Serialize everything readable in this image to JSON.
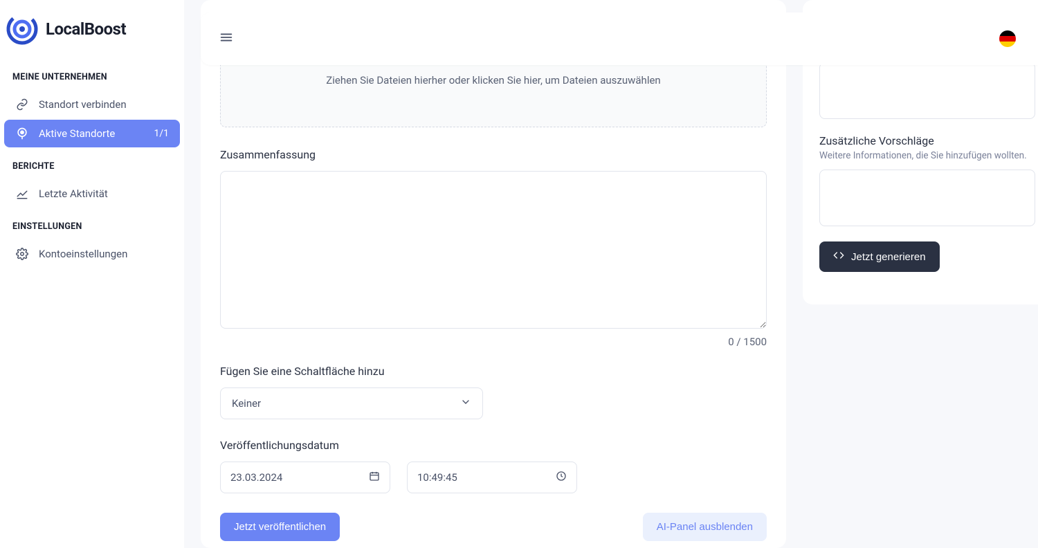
{
  "brand": {
    "name": "LocalBoost"
  },
  "sidebar": {
    "sections": [
      {
        "title": "MEINE UNTERNEHMEN",
        "items": [
          {
            "label": "Standort verbinden"
          },
          {
            "label": "Aktive Standorte",
            "badge": "1/1",
            "active": true
          }
        ]
      },
      {
        "title": "BERICHTE",
        "items": [
          {
            "label": "Letzte Aktivität"
          }
        ]
      },
      {
        "title": "EINSTELLUNGEN",
        "items": [
          {
            "label": "Kontoeinstellungen"
          }
        ]
      }
    ]
  },
  "main": {
    "dropzone_text": "Ziehen Sie Dateien hierher oder klicken Sie hier, um Dateien auszuwählen",
    "summary_label": "Zusammenfassung",
    "summary_value": "",
    "char_counter": "0 / 1500",
    "add_button_label": "Fügen Sie eine Schaltfläche hinzu",
    "add_button_selected": "Keiner",
    "publish_date_label": "Veröffentlichungsdatum",
    "publish_date_value": "23.03.2024",
    "publish_time_value": "10:49:45",
    "publish_now_label": "Jetzt veröffentlichen",
    "hide_ai_label": "AI-Panel ausblenden"
  },
  "ai": {
    "extra_title": "Zusätzliche Vorschläge",
    "extra_sub": "Weitere Informationen, die Sie hinzufügen wollten.",
    "generate_label": "Jetzt generieren"
  }
}
